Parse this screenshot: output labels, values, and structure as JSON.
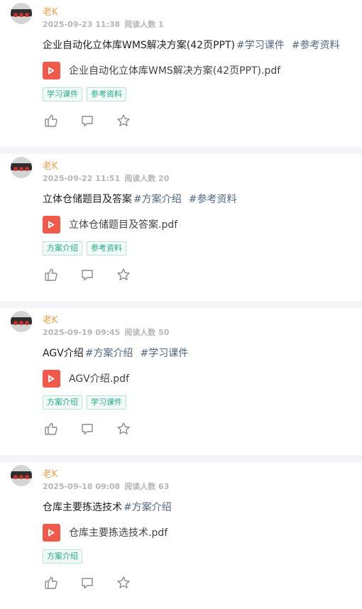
{
  "colors": {
    "author": "#f0a04b",
    "tag": "#51677f",
    "chip": "#1fab89",
    "pdf": "#ef5a4c"
  },
  "icons": {
    "file": "pdf-icon",
    "like": "thumbs-up-icon",
    "comment": "comment-icon",
    "favorite": "star-icon"
  },
  "posts": [
    {
      "author": "老K",
      "date": "2025-09-23 11:38",
      "reads": "阅读人数 1",
      "title": "企业自动化立体库WMS解决方案(42页PPT)",
      "tags": [
        "#学习课件",
        "#参考资料"
      ],
      "file": "企业自动化立体库WMS解决方案(42页PPT).pdf",
      "chips": [
        "学习课件",
        "参考资料"
      ]
    },
    {
      "author": "老K",
      "date": "2025-09-22 11:51",
      "reads": "阅读人数 20",
      "title": "立体仓储题目及答案",
      "tags": [
        "#方案介绍",
        "#参考资料"
      ],
      "file": "立体仓储题目及答案.pdf",
      "chips": [
        "方案介绍",
        "参考资料"
      ]
    },
    {
      "author": "老K",
      "date": "2025-09-19 09:45",
      "reads": "阅读人数 50",
      "title": "AGV介绍",
      "tags": [
        "#方案介绍",
        "#学习课件"
      ],
      "file": "AGV介绍.pdf",
      "chips": [
        "方案介绍",
        "学习课件"
      ]
    },
    {
      "author": "老K",
      "date": "2025-09-18 09:08",
      "reads": "阅读人数 63",
      "title": "仓库主要拣选技术",
      "tags": [
        "#方案介绍"
      ],
      "file": "仓库主要拣选技术.pdf",
      "chips": [
        "方案介绍"
      ]
    }
  ]
}
